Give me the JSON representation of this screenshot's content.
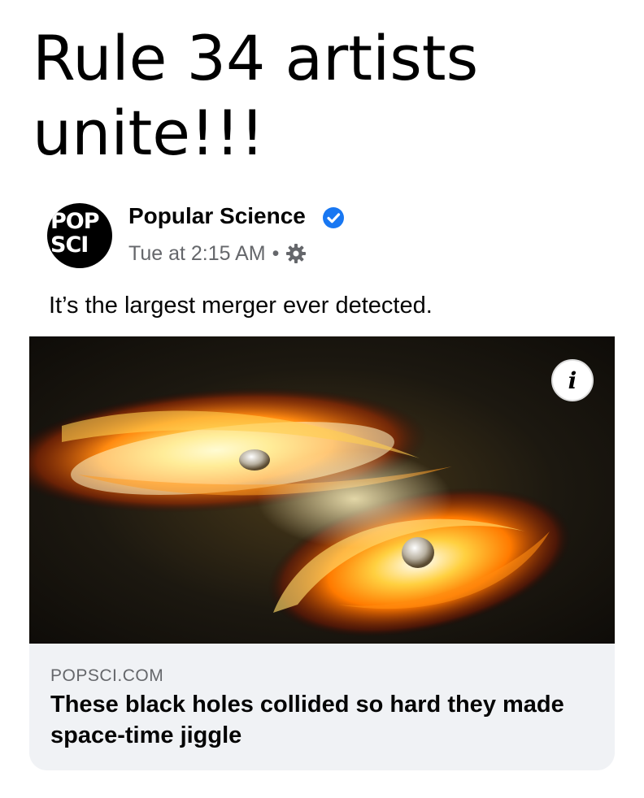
{
  "meme": {
    "caption": "Rule 34 artists unite!!!"
  },
  "post": {
    "avatar_text": "POP\nSCI",
    "page_name": "Popular Science",
    "timestamp": "Tue at 2:15 AM",
    "separator": "•",
    "text": "It’s the largest merger ever detected.",
    "icons": [
      "verified-badge-icon",
      "gear-icon",
      "info-icon"
    ],
    "colors": {
      "verified": "#1877f2",
      "meta_text": "#65676b",
      "card_bg": "#f0f2f5"
    }
  },
  "link_card": {
    "domain": "POPSCI.COM",
    "title": "These black holes collided so hard they made space-time jiggle",
    "info_label": "i"
  }
}
